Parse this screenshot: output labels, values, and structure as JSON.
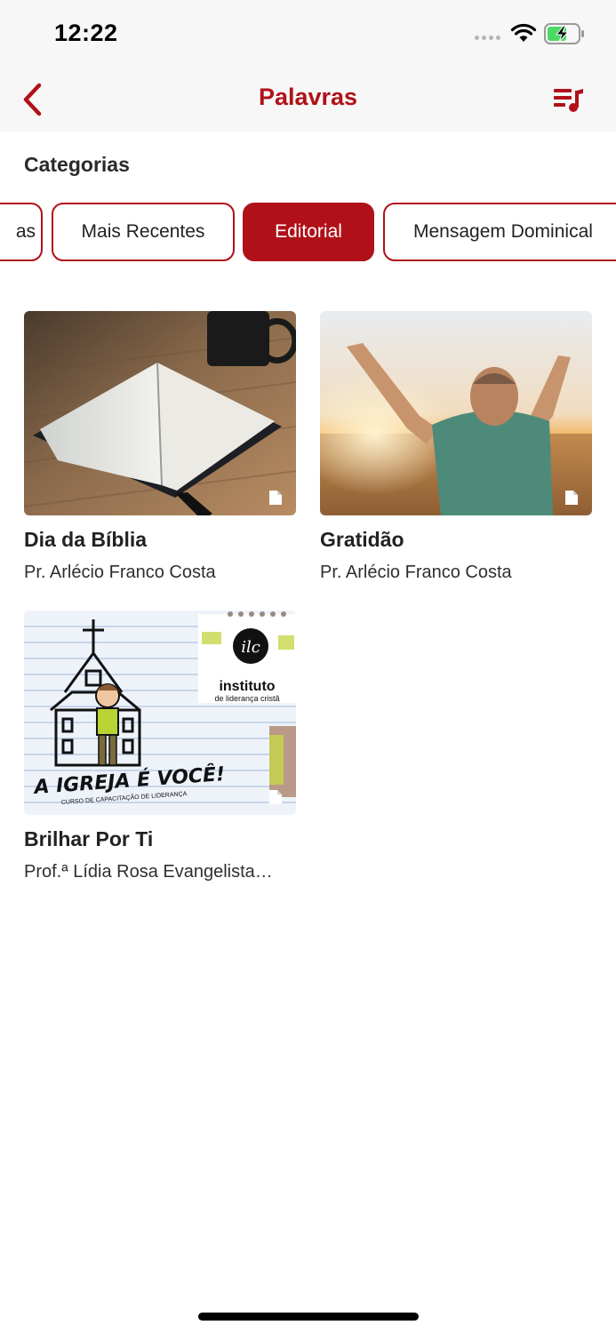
{
  "status_bar": {
    "time": "12:22"
  },
  "nav": {
    "title": "Palavras",
    "back_icon": "chevron-left-icon",
    "playlist_icon": "music-playlist-icon"
  },
  "categories": {
    "title": "Categorias",
    "chips": [
      {
        "label": "as",
        "active": false
      },
      {
        "label": "Mais Recentes",
        "active": false
      },
      {
        "label": "Editorial",
        "active": true
      },
      {
        "label": "Mensagem Dominical",
        "active": false
      }
    ]
  },
  "cards": [
    {
      "title": "Dia da Bíblia",
      "author": "Pr. Arlécio Franco Costa",
      "image": "open-bible-on-table"
    },
    {
      "title": "Gratidão",
      "author": "Pr. Arlécio Franco Costa",
      "image": "man-arms-raised-in-field"
    },
    {
      "title": "Brilhar Por Ti",
      "author": "Prof.ª Lídia Rosa Evangelista…",
      "image": "church-illustration",
      "image_text": {
        "headline": "A IGREJA É VOCÊ!",
        "subline": "CURSO DE CAPACITAÇÃO DE LIDERANÇA",
        "logo": "ilc",
        "org": "instituto",
        "org_sub": "de liderança cristã"
      }
    }
  ],
  "colors": {
    "accent": "#b01119",
    "nav_background": "#f7f7f7"
  }
}
